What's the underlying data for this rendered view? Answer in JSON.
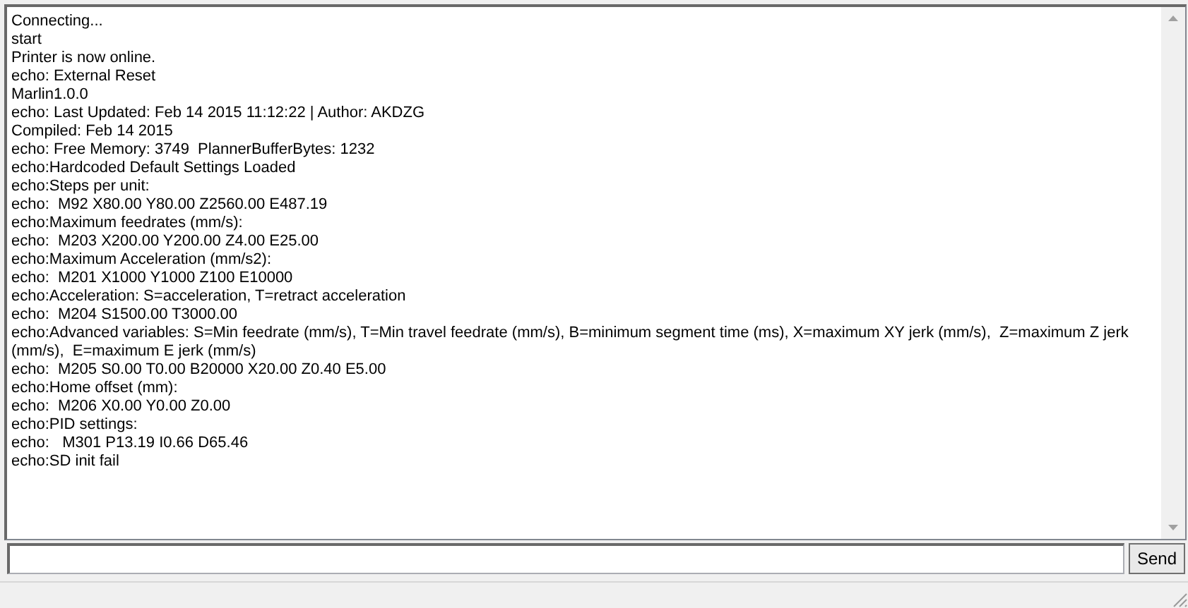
{
  "log": {
    "lines": [
      "Connecting...",
      "start",
      "Printer is now online.",
      "echo: External Reset",
      "Marlin1.0.0",
      "echo: Last Updated: Feb 14 2015 11:12:22 | Author: AKDZG",
      "Compiled: Feb 14 2015",
      "echo: Free Memory: 3749  PlannerBufferBytes: 1232",
      "echo:Hardcoded Default Settings Loaded",
      "echo:Steps per unit:",
      "echo:  M92 X80.00 Y80.00 Z2560.00 E487.19",
      "echo:Maximum feedrates (mm/s):",
      "echo:  M203 X200.00 Y200.00 Z4.00 E25.00",
      "echo:Maximum Acceleration (mm/s2):",
      "echo:  M201 X1000 Y1000 Z100 E10000",
      "echo:Acceleration: S=acceleration, T=retract acceleration",
      "echo:  M204 S1500.00 T3000.00",
      "echo:Advanced variables: S=Min feedrate (mm/s), T=Min travel feedrate (mm/s), B=minimum segment time (ms), X=maximum XY jerk (mm/s),  Z=maximum Z jerk (mm/s),  E=maximum E jerk (mm/s)",
      "echo:  M205 S0.00 T0.00 B20000 X20.00 Z0.40 E5.00",
      "echo:Home offset (mm):",
      "echo:  M206 X0.00 Y0.00 Z0.00",
      "echo:PID settings:",
      "echo:   M301 P13.19 I0.66 D65.46",
      "echo:SD init fail"
    ]
  },
  "command": {
    "button": "Send"
  }
}
